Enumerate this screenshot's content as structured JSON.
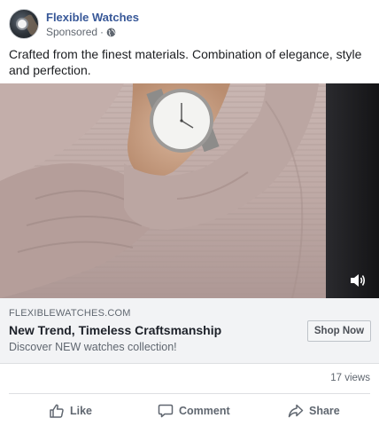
{
  "post": {
    "page_name": "Flexible Watches",
    "sponsored_label": "Sponsored",
    "separator": " · ",
    "caption": "Crafted from the finest materials. Combination of elegance, style and perfection."
  },
  "ad": {
    "domain": "FLEXIBLEWATCHES.COM",
    "headline": "New Trend, Timeless Craftsmanship",
    "description": "Discover NEW watches collection!",
    "cta_label": "Shop Now"
  },
  "stats": {
    "views": "17 views"
  },
  "actions": {
    "like_label": "Like",
    "comment_label": "Comment",
    "share_label": "Share"
  },
  "icons": {
    "globe": "globe-icon",
    "sound": "sound-icon",
    "like": "thumbs-up-icon",
    "comment": "comment-bubble-icon",
    "share": "share-arrow-icon"
  },
  "colors": {
    "page_name": "#385898",
    "secondary_text": "#606770",
    "cta_background": "#f2f3f5"
  }
}
